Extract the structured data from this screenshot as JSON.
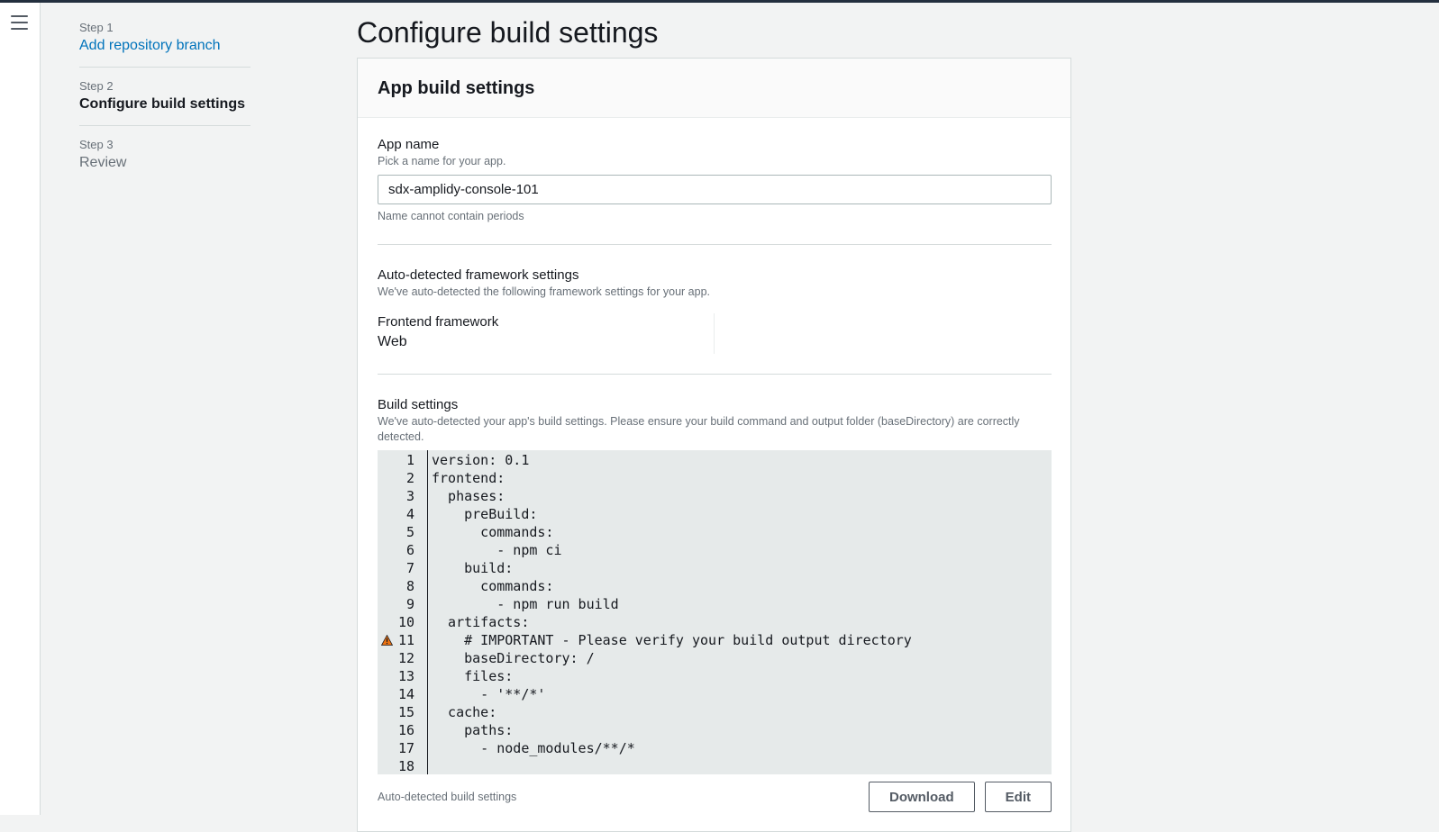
{
  "nav": {
    "menu_icon": "hamburger-icon"
  },
  "steps": [
    {
      "number": "Step 1",
      "label": "Add repository branch",
      "state": "link"
    },
    {
      "number": "Step 2",
      "label": "Configure build settings",
      "state": "active"
    },
    {
      "number": "Step 3",
      "label": "Review",
      "state": "disabled"
    }
  ],
  "page": {
    "title": "Configure build settings"
  },
  "panel": {
    "title": "App build settings",
    "app_name": {
      "label": "App name",
      "description": "Pick a name for your app.",
      "value": "sdx-amplidy-console-101",
      "constraint": "Name cannot contain periods"
    },
    "framework": {
      "label": "Auto-detected framework settings",
      "description": "We've auto-detected the following framework settings for your app.",
      "frontend_label": "Frontend framework",
      "frontend_value": "Web"
    },
    "build": {
      "label": "Build settings",
      "description": "We've auto-detected your app's build settings. Please ensure your build command and output folder (baseDirectory) are correctly detected.",
      "warning_line": 11,
      "code_lines": [
        "version: 0.1",
        "frontend:",
        "  phases:",
        "    preBuild:",
        "      commands:",
        "        - npm ci",
        "    build:",
        "      commands:",
        "        - npm run build",
        "  artifacts:",
        "    # IMPORTANT - Please verify your build output directory",
        "    baseDirectory: /",
        "    files:",
        "      - '**/*'",
        "  cache:",
        "    paths:",
        "      - node_modules/**/*",
        ""
      ],
      "footer_note": "Auto-detected build settings",
      "download_label": "Download",
      "edit_label": "Edit"
    }
  },
  "colors": {
    "link": "#0073bb",
    "warning": "#ec7211"
  }
}
